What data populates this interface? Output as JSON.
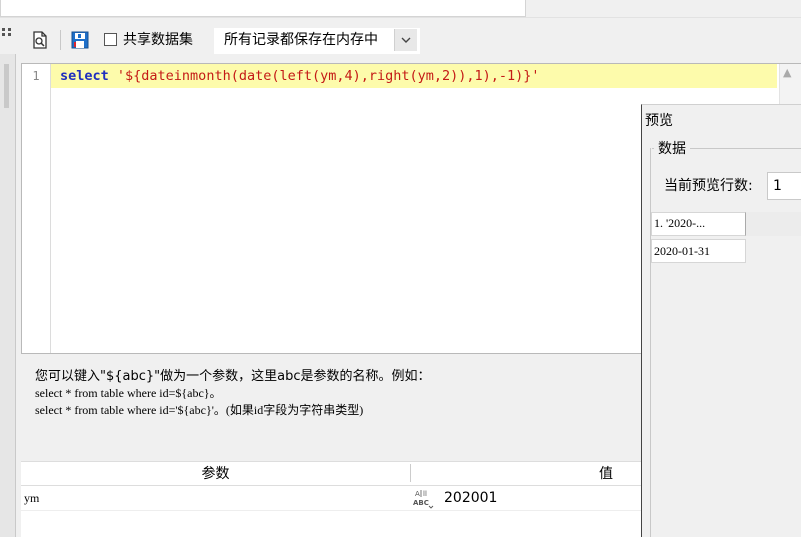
{
  "toolbar": {
    "icons": [
      "preview-doc-icon",
      "save-icon"
    ],
    "share_label": "共享数据集",
    "share_checked": false,
    "mode_value": "所有记录都保存在内存中"
  },
  "editor": {
    "line_number": "1",
    "code_keyword": "select",
    "code_string": " '${dateinmonth(date(left(ym,4),right(ym,2)),1),-1)}'"
  },
  "hint": {
    "line1": "您可以键入\"${abc}\"做为一个参数，这里abc是参数的名称。例如：",
    "line2": "select * from table where id=${abc}。",
    "line3": "select * from table where id='${abc}'。(如果id字段为字符串类型)"
  },
  "params": {
    "headers": [
      "参数",
      "值"
    ],
    "rows": [
      {
        "name": "ym",
        "value": "202001"
      }
    ]
  },
  "preview": {
    "title": "预览",
    "group_label": "数据",
    "rows_label": "当前预览行数:",
    "rows_value": "1",
    "grid": {
      "header": "1. '2020-...",
      "cell": "2020-01-31"
    }
  },
  "colors": {
    "keyword": "#1f2fbf",
    "string": "#c41a16",
    "line_highlight": "#fdfbab"
  }
}
